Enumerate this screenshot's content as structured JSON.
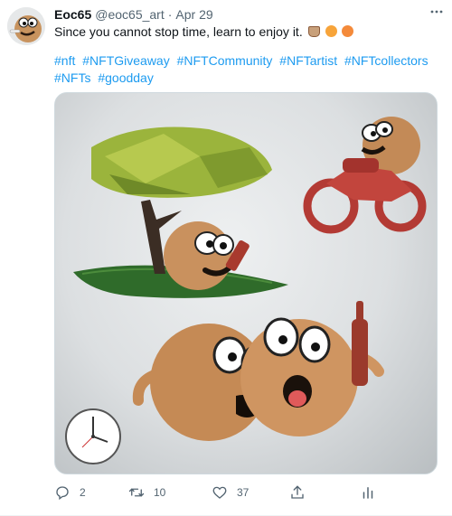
{
  "tweet": {
    "author_name": "Eoc65",
    "author_handle": "@eoc65_art",
    "separator": "·",
    "date": "Apr 29",
    "text": "Since you cannot stop time, learn to enjoy it.",
    "hashtags": [
      "#nft",
      "#NFTGiveaway",
      "#NFTCommunity",
      "#NFTartist",
      "#NFTcollectors",
      "#NFTs",
      "#goodday"
    ],
    "media_icons": [
      "tree-icon",
      "motorcycle-icon",
      "clock-icon",
      "beer-bottle-icon"
    ],
    "actions": {
      "reply_count": "2",
      "retweet_count": "10",
      "like_count": "37"
    },
    "colors": {
      "link": "#1d9bf0",
      "muted": "#536471",
      "text": "#0f1419"
    }
  }
}
